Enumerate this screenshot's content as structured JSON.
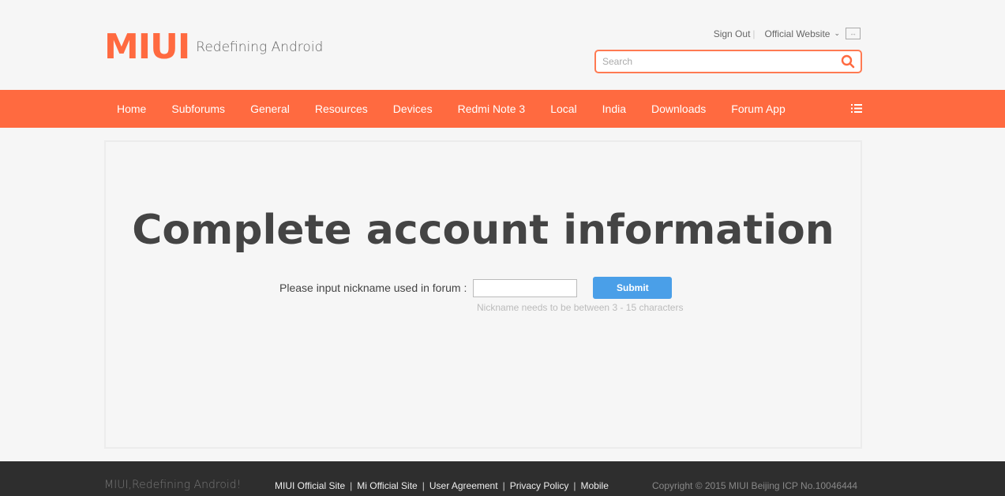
{
  "header": {
    "logo": "MIUI",
    "tagline": "Redefining Android",
    "sign_out": "Sign Out",
    "official_website": "Official Website",
    "search_placeholder": "Search"
  },
  "nav": [
    "Home",
    "Subforums",
    "General",
    "Resources",
    "Devices",
    "Redmi Note 3",
    "Local",
    "India",
    "Downloads",
    "Forum App"
  ],
  "main": {
    "title": "Complete account information",
    "label": "Please input nickname used in forum :",
    "nickname_value": "",
    "submit": "Submit",
    "hint": "Nickname needs to be between 3 - 15 characters"
  },
  "footer": {
    "slogan": "MIUI,Redefining Android!",
    "links": [
      "MIUI Official Site",
      "Mi Official Site",
      "User Agreement",
      "Privacy Policy",
      "Mobile"
    ],
    "copyright": "Copyright © 2015 MIUI Beijing ICP No.10046444"
  },
  "colors": {
    "brand": "#ff6a40",
    "button": "#4a9fe8"
  }
}
